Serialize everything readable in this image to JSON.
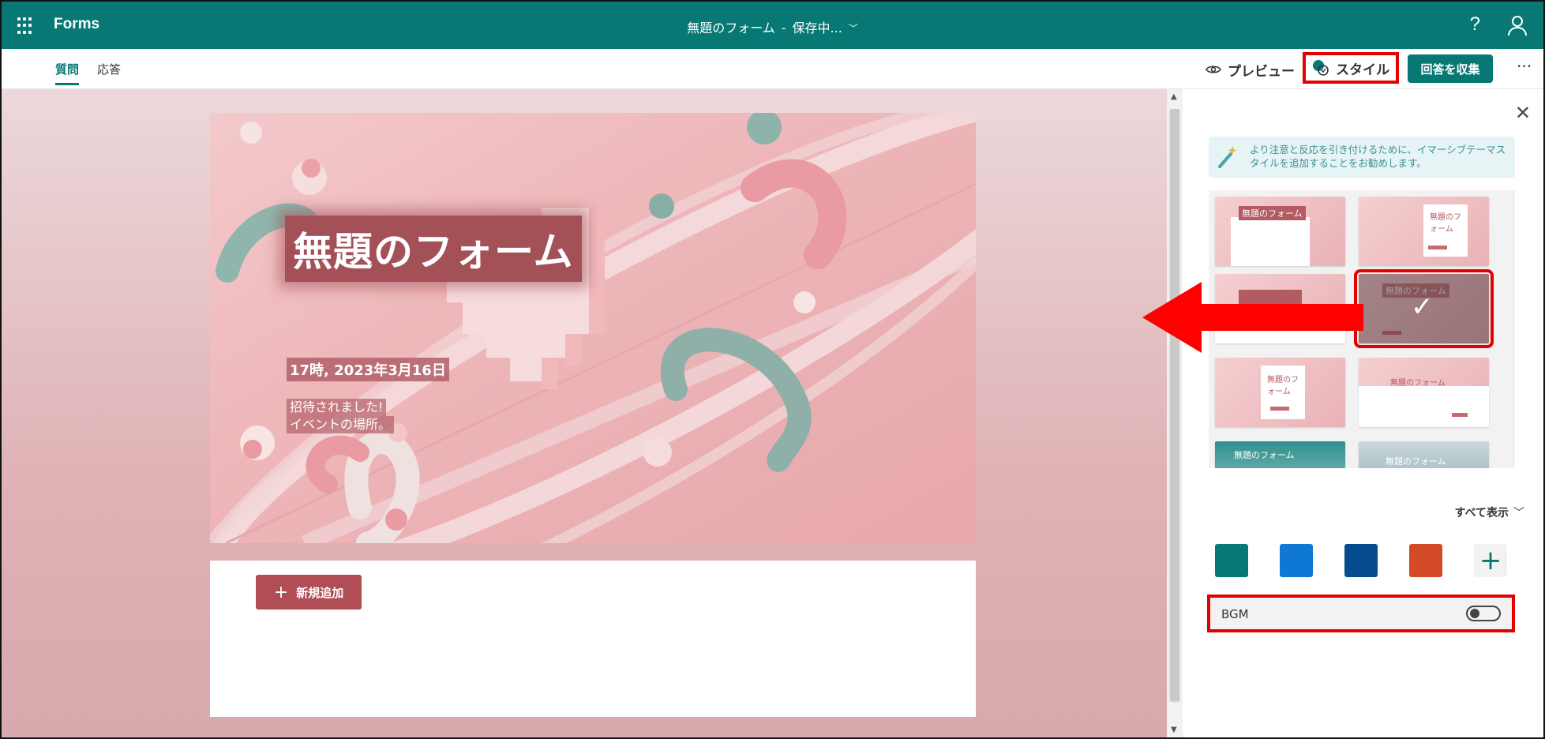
{
  "app": {
    "name": "Forms"
  },
  "document": {
    "title": "無題のフォーム",
    "separator": "-",
    "status": "保存中..."
  },
  "header": {
    "help_glyph": "?"
  },
  "tabs": [
    {
      "label": "質問",
      "active": true
    },
    {
      "label": "応答",
      "active": false
    }
  ],
  "toolbar": {
    "preview_label": "プレビュー",
    "style_label": "スタイル",
    "collect_label": "回答を収集",
    "more_glyph": "···"
  },
  "hero": {
    "title": "無題のフォーム",
    "date": "17時, 2023年3月16日",
    "description_lines": [
      "招待されました!",
      "イベントの場所。"
    ]
  },
  "form": {
    "add_new_label": "新規追加"
  },
  "style_pane": {
    "tip": "より注意と反応を引き付けるために、イマーシブテーマスタイルを追加することをお勧めします。",
    "theme_thumbnails": [
      {
        "label": "無題のフォーム",
        "selected": false
      },
      {
        "label": "無題のフォーム",
        "selected": false
      },
      {
        "label": "",
        "selected": false
      },
      {
        "label": "無題のフォーム",
        "selected": true
      },
      {
        "label": "無題のフォーム",
        "selected": false
      },
      {
        "label": "無題のフォーム",
        "selected": false
      },
      {
        "label": "無題のフォーム",
        "selected": false
      },
      {
        "label": "無題のフォーム",
        "selected": false
      }
    ],
    "show_all_label": "すべて表示",
    "color_swatches": [
      "#077873",
      "#0f78d4",
      "#064b8f",
      "#d24a26"
    ],
    "bgm_label": "BGM",
    "bgm_enabled": false
  },
  "colors": {
    "brand": "#077873",
    "highlight": "#e30000",
    "accent_button": "#b04d55"
  }
}
